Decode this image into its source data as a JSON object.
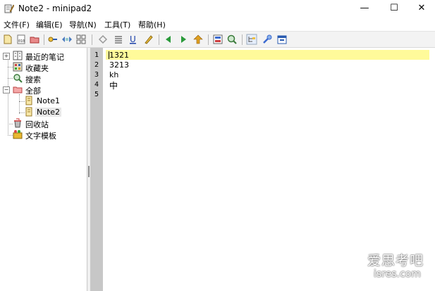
{
  "window": {
    "title": "Note2 - minipad2",
    "min_glyph": "—",
    "max_glyph": "☐",
    "close_glyph": "✕"
  },
  "menu": [
    {
      "label": "文件(F)"
    },
    {
      "label": "编辑(E)"
    },
    {
      "label": "导航(N)"
    },
    {
      "label": "工具(T)"
    },
    {
      "label": "帮助(H)"
    }
  ],
  "toolbar": {
    "icons": [
      "new-note-icon",
      "new-template-icon",
      "new-folder-icon",
      "link-icon",
      "view-icon",
      "grid-icon",
      "undo-icon",
      "format-icon",
      "underline-icon",
      "highlight-icon",
      "back-icon",
      "forward-icon",
      "up-icon",
      "properties-icon",
      "search-icon",
      "tree-icon",
      "tools-icon",
      "window-icon"
    ]
  },
  "tree": {
    "items": [
      {
        "label": "最近的笔记",
        "icon": "recent-notes-icon"
      },
      {
        "label": "收藏夹",
        "icon": "favorites-icon"
      },
      {
        "label": "搜索",
        "icon": "search-icon"
      },
      {
        "label": "全部",
        "icon": "folder-icon"
      },
      {
        "label": "Note1",
        "icon": "note-icon"
      },
      {
        "label": "Note2",
        "icon": "note-icon"
      },
      {
        "label": "回收站",
        "icon": "recycle-bin-icon"
      },
      {
        "label": "文字模板",
        "icon": "template-icon"
      }
    ],
    "expanders": {
      "collapsed": "+",
      "expanded": "−"
    }
  },
  "editor": {
    "line_numbers": [
      "1",
      "2",
      "3",
      "4",
      "5"
    ],
    "lines": [
      "1321",
      "3213",
      "kh",
      "中",
      ""
    ],
    "current_line_color": "#fffa9a"
  },
  "watermark": {
    "main": "爱思考吧",
    "sub": "isres.com"
  }
}
